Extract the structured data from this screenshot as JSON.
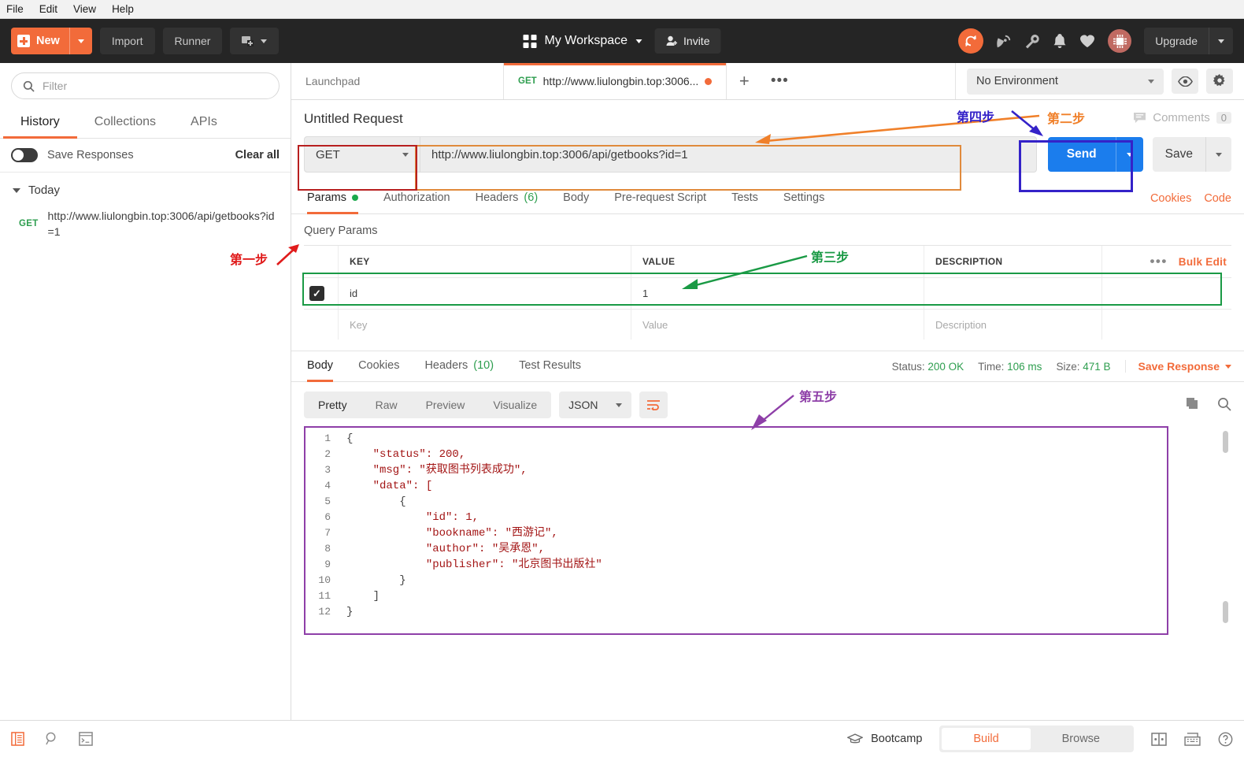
{
  "menubar": {
    "items": [
      "File",
      "Edit",
      "View",
      "Help"
    ]
  },
  "header": {
    "new_label": "New",
    "import_label": "Import",
    "runner_label": "Runner",
    "workspace_label": "My Workspace",
    "invite_label": "Invite",
    "upgrade_label": "Upgrade",
    "icons": [
      "sync-icon",
      "satellite-icon",
      "wrench-icon",
      "bell-icon",
      "heart-icon",
      "avatar-icon"
    ]
  },
  "sidebar": {
    "filter_placeholder": "Filter",
    "tabs": [
      "History",
      "Collections",
      "APIs"
    ],
    "active_tab": "History",
    "save_responses_label": "Save Responses",
    "clear_all_label": "Clear all",
    "group_label": "Today",
    "history": [
      {
        "method": "GET",
        "url": "http://www.liulongbin.top:3006/api/getbooks?id=1"
      }
    ]
  },
  "tabs": {
    "launchpad_label": "Launchpad",
    "request_method": "GET",
    "request_title": "http://www.liulongbin.top:3006...",
    "plus_label": "+",
    "more_label": "•••"
  },
  "environment": {
    "selected": "No Environment",
    "eye_icon": "eye-icon",
    "gear_icon": "gear-icon"
  },
  "request": {
    "name": "Untitled Request",
    "comments_label": "Comments",
    "comments_count": "0",
    "method": "GET",
    "url": "http://www.liulongbin.top:3006/api/getbooks?id=1",
    "send_label": "Send",
    "save_label": "Save",
    "tabs": [
      {
        "label": "Params",
        "badge": "",
        "dot": true
      },
      {
        "label": "Authorization",
        "badge": "",
        "dot": false
      },
      {
        "label": "Headers",
        "badge": "(6)",
        "dot": false
      },
      {
        "label": "Body",
        "badge": "",
        "dot": false
      },
      {
        "label": "Pre-request Script",
        "badge": "",
        "dot": false
      },
      {
        "label": "Tests",
        "badge": "",
        "dot": false
      },
      {
        "label": "Settings",
        "badge": "",
        "dot": false
      }
    ],
    "cookies_label": "Cookies",
    "code_label": "Code"
  },
  "params": {
    "section_title": "Query Params",
    "columns": [
      "KEY",
      "VALUE",
      "DESCRIPTION"
    ],
    "bulk_edit_label": "Bulk Edit",
    "rows": [
      {
        "checked": true,
        "key": "id",
        "value": "1",
        "description": ""
      }
    ],
    "placeholder_row": {
      "key": "Key",
      "value": "Value",
      "description": "Description"
    }
  },
  "response": {
    "tabs": [
      {
        "label": "Body",
        "badge": ""
      },
      {
        "label": "Cookies",
        "badge": ""
      },
      {
        "label": "Headers",
        "badge": "(10)"
      },
      {
        "label": "Test Results",
        "badge": ""
      }
    ],
    "status_label": "Status:",
    "status_value": "200 OK",
    "time_label": "Time:",
    "time_value": "106 ms",
    "size_label": "Size:",
    "size_value": "471 B",
    "save_response_label": "Save Response",
    "view_modes": [
      "Pretty",
      "Raw",
      "Preview",
      "Visualize"
    ],
    "active_view": "Pretty",
    "format": "JSON",
    "copy_icon": "copy-icon",
    "search_icon": "search-icon",
    "line_numbers": [
      "1",
      "2",
      "3",
      "4",
      "5",
      "6",
      "7",
      "8",
      "9",
      "10",
      "11",
      "12"
    ],
    "body_lines": [
      "{",
      "    \"status\": 200,",
      "    \"msg\": \"获取图书列表成功\",",
      "    \"data\": [",
      "        {",
      "            \"id\": 1,",
      "            \"bookname\": \"西游记\",",
      "            \"author\": \"吴承恩\",",
      "            \"publisher\": \"北京图书出版社\"",
      "        }",
      "    ]",
      "}"
    ],
    "body_json": {
      "status": 200,
      "msg": "获取图书列表成功",
      "data": [
        {
          "id": 1,
          "bookname": "西游记",
          "author": "吴承恩",
          "publisher": "北京图书出版社"
        }
      ]
    }
  },
  "footer": {
    "icons": [
      "console-icon",
      "find-icon",
      "terminal-icon"
    ],
    "bootcamp_label": "Bootcamp",
    "build_label": "Build",
    "browse_label": "Browse",
    "active_mode": "Build",
    "right_icons": [
      "two-pane-icon",
      "keyboard-icon",
      "help-icon"
    ]
  },
  "annotations": [
    {
      "text": "第一步",
      "color": "#e01b1b",
      "meaning": "step-1-history-item"
    },
    {
      "text": "第二步",
      "color": "#f0802a",
      "meaning": "step-2-url-field"
    },
    {
      "text": "第三步",
      "color": "#1a9a45",
      "meaning": "step-3-query-params"
    },
    {
      "text": "第四步",
      "color": "#3422c8",
      "meaning": "step-4-send-button"
    },
    {
      "text": "第五步",
      "color": "#8e3fa8",
      "meaning": "step-5-response-body"
    }
  ]
}
